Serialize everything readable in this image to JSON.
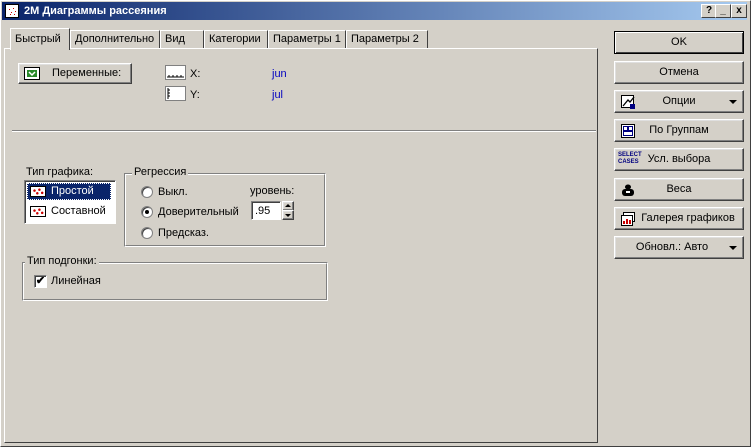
{
  "window": {
    "title": "2M Диаграммы рассеяния",
    "help_btn": "?",
    "min_btn": "_",
    "close_btn": "x"
  },
  "tabs": [
    {
      "label": "Быстрый",
      "active": true
    },
    {
      "label": "Дополнительно",
      "active": false
    },
    {
      "label": "Вид",
      "active": false
    },
    {
      "label": "Категории",
      "active": false
    },
    {
      "label": "Параметры 1",
      "active": false
    },
    {
      "label": "Параметры 2",
      "active": false
    }
  ],
  "variables": {
    "button_label": "Переменные:",
    "x_label": "X:",
    "x_value": "jun",
    "y_label": "Y:",
    "y_value": "jul"
  },
  "graph_type": {
    "label": "Тип графика:",
    "items": [
      {
        "label": "Простой",
        "selected": true
      },
      {
        "label": "Составной",
        "selected": false
      }
    ]
  },
  "regression": {
    "label": "Регрессия",
    "options": [
      {
        "label": "Выкл.",
        "checked": false
      },
      {
        "label": "Доверительный",
        "checked": true
      },
      {
        "label": "Предсказ.",
        "checked": false
      }
    ],
    "level_label": "уровень:",
    "level_value": ".95"
  },
  "fit_type": {
    "label": "Тип подгонки:",
    "checkbox_label": "Линейная",
    "checked": true,
    "check_glyph": "✔"
  },
  "sidebar": {
    "ok": "OK",
    "cancel": "Отмена",
    "options": "Опции",
    "by_group": "По Группам",
    "select_cases": "Усл. выбора",
    "select_cases_icon_text": "SELECT CASES",
    "weights": "Веса",
    "gallery": "Галерея графиков",
    "update": "Обновл.: Авто"
  },
  "colors": {
    "title_start": "#0a246a",
    "title_end": "#a6caf0",
    "face": "#d4d0c8",
    "link": "#0000c0",
    "selection": "#0a246a"
  }
}
